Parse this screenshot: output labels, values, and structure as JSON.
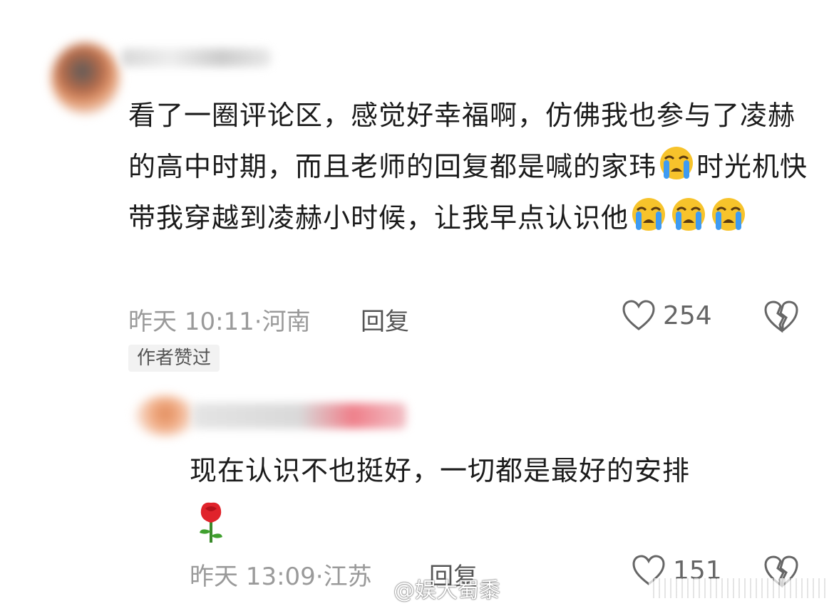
{
  "main_comment": {
    "text_parts": {
      "part1": "看了一圈评论区，感觉好幸福啊，仿佛我也参与了凌赫的高中时期，而且老师的回复都是喊的家玮",
      "part2": "时光机快带我穿越到凌赫小时候，让我早点认识他"
    },
    "emoji": "loudly-crying-face",
    "time": "昨天 10:11",
    "separator": "·",
    "location": "河南",
    "reply_label": "回复",
    "likes": "254",
    "author_badge": "作者赞过"
  },
  "reply_comment": {
    "text": "现在认识不也挺好，一切都是最好的安排",
    "emoji": "rose",
    "time": "昨天 13:09",
    "separator": "·",
    "location": "江苏",
    "reply_label": "回复",
    "likes": "151"
  },
  "watermark": {
    "text": "@娱大蜀黍",
    "logo": "weibo-icon"
  },
  "colors": {
    "text": "#1b1b1b",
    "meta": "#9a9a9a",
    "emoji_face": "#f7c32b",
    "emoji_tear": "#3e9bf2",
    "rose": "#e0232b"
  }
}
